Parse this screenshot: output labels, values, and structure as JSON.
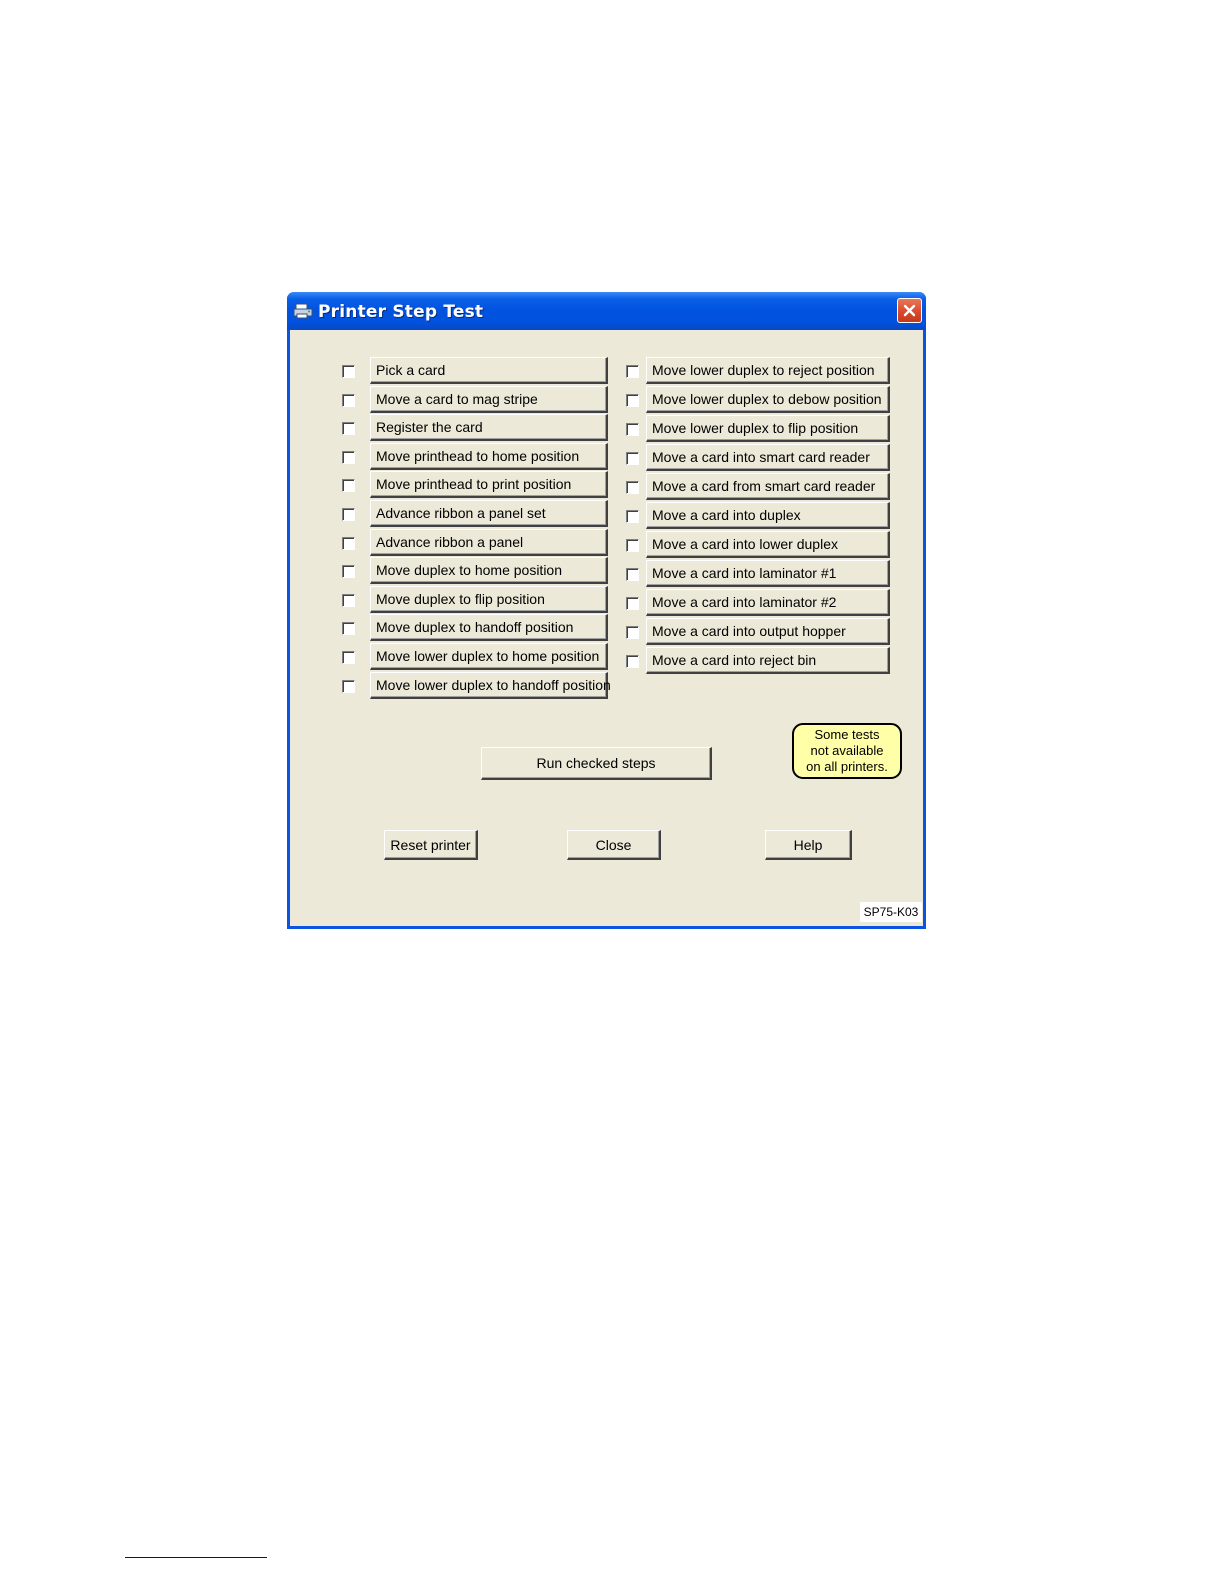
{
  "window": {
    "title": "Printer Step Test"
  },
  "left_steps": [
    {
      "label": "Pick a card",
      "checked": false
    },
    {
      "label": "Move a card to mag stripe",
      "checked": false
    },
    {
      "label": "Register the card",
      "checked": false
    },
    {
      "label": "Move printhead to home position",
      "checked": false
    },
    {
      "label": "Move printhead to print position",
      "checked": false
    },
    {
      "label": "Advance ribbon a panel set",
      "checked": false
    },
    {
      "label": "Advance ribbon a panel",
      "checked": false
    },
    {
      "label": "Move duplex to home position",
      "checked": false
    },
    {
      "label": "Move duplex to flip position",
      "checked": false
    },
    {
      "label": "Move duplex to handoff position",
      "checked": false
    },
    {
      "label": "Move lower duplex to home position",
      "checked": false
    },
    {
      "label": "Move lower duplex to handoff position",
      "checked": false
    }
  ],
  "right_steps": [
    {
      "label": "Move lower duplex to reject position",
      "checked": false
    },
    {
      "label": "Move lower duplex to debow position",
      "checked": false
    },
    {
      "label": "Move lower duplex to flip position",
      "checked": false
    },
    {
      "label": "Move a card into smart card reader",
      "checked": false
    },
    {
      "label": "Move a card from smart card reader",
      "checked": false
    },
    {
      "label": "Move a card into duplex",
      "checked": false
    },
    {
      "label": "Move a card into lower duplex",
      "checked": false
    },
    {
      "label": "Move a card into laminator #1",
      "checked": false
    },
    {
      "label": "Move a card into laminator #2",
      "checked": false
    },
    {
      "label": "Move a card into output hopper",
      "checked": false
    },
    {
      "label": "Move a card into reject bin",
      "checked": false
    }
  ],
  "buttons": {
    "run": "Run checked steps",
    "reset": "Reset printer",
    "close": "Close",
    "help": "Help"
  },
  "note": {
    "lines": [
      "Some tests",
      "not available",
      "on all printers."
    ]
  },
  "stamp": "SP75-K03",
  "icons": {
    "title": "printer-icon",
    "close": "close-icon"
  },
  "colors": {
    "titlebar": "#0052df",
    "window_bg": "#ece9d8",
    "close_button": "#d9462a",
    "note_bg": "#ffffa8"
  }
}
